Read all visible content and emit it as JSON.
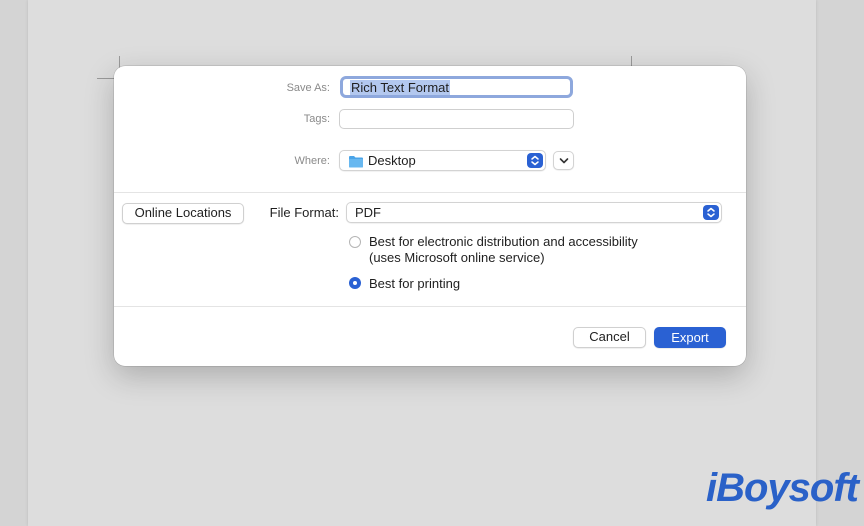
{
  "dialog": {
    "save_as_label": "Save As:",
    "save_as_value": "Rich Text Format",
    "tags_label": "Tags:",
    "tags_value": "",
    "where_label": "Where:",
    "where_value": "Desktop",
    "where_icon": "folder-icon",
    "online_locations_label": "Online Locations",
    "file_format_label": "File Format:",
    "file_format_value": "PDF",
    "options": [
      {
        "label_line1": "Best for electronic distribution and accessibility",
        "label_line2": "(uses Microsoft online service)",
        "selected": false
      },
      {
        "label_line1": "Best for printing",
        "selected": true
      }
    ],
    "cancel_label": "Cancel",
    "export_label": "Export"
  },
  "watermark": "iBoysoft",
  "colors": {
    "accent": "#2a61d3",
    "focus_ring": "#8ea8dd",
    "selection": "#b3c8ef",
    "watermark": "#2a61c8"
  }
}
